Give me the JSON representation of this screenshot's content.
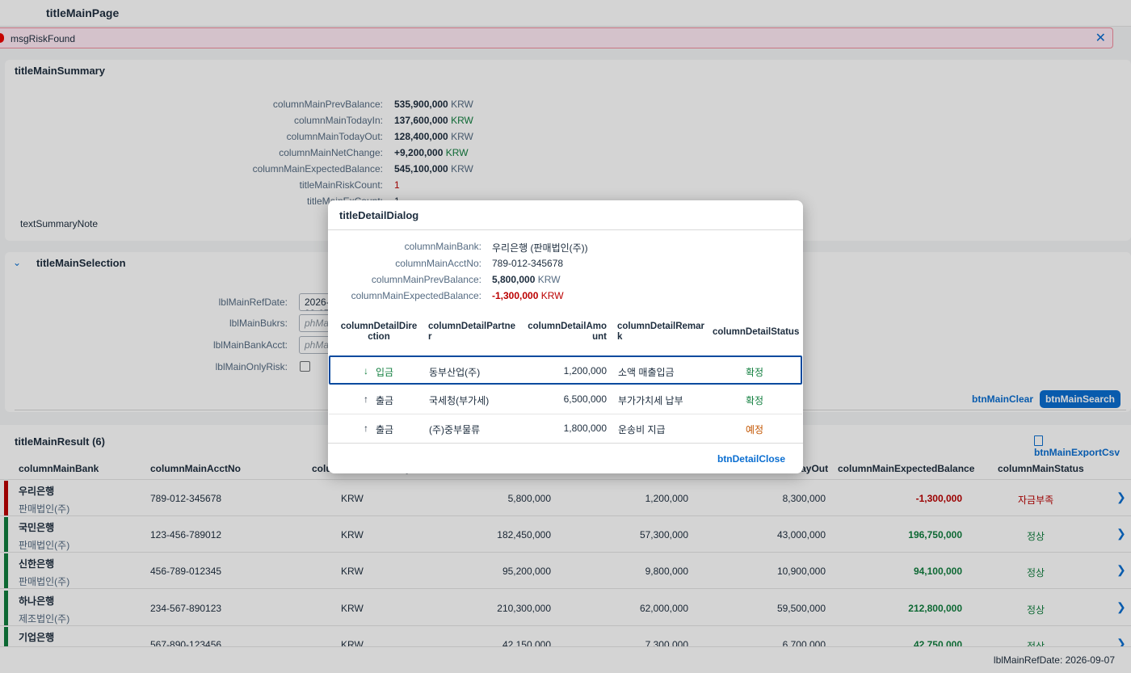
{
  "page": {
    "title": "titleMainPage"
  },
  "message": {
    "text": "msgRiskFound",
    "close_icon": "✕"
  },
  "summary": {
    "title": "titleMainSummary",
    "rows": [
      {
        "label": "columnMainPrevBalance:",
        "value": "535,900,000",
        "unit": "KRW"
      },
      {
        "label": "columnMainTodayIn:",
        "value": "137,600,000",
        "unit": "KRW"
      },
      {
        "label": "columnMainTodayOut:",
        "value": "128,400,000",
        "unit": "KRW"
      },
      {
        "label": "columnMainNetChange:",
        "value": "+9,200,000",
        "unit": "KRW"
      },
      {
        "label": "columnMainExpectedBalance:",
        "value": "545,100,000",
        "unit": "KRW"
      },
      {
        "label": "titleMainRiskCount:",
        "value": "1",
        "unit": ""
      },
      {
        "label": "titleMainExCount:",
        "value": "1",
        "unit": ""
      }
    ],
    "note": "textSummaryNote"
  },
  "selection": {
    "title": "titleMainSelection",
    "ref_date_label": "lblMainRefDate:",
    "ref_date_value": "2026-09-07",
    "bukrs_label": "lblMainBukrs:",
    "bukrs_placeholder": "phMainBukrs",
    "bank_acct_label": "lblMainBankAcct:",
    "bank_acct_placeholder": "phMainBankAcct",
    "only_risk_label": "lblMainOnlyRisk:",
    "btn_clear": "btnMainClear",
    "btn_search": "btnMainSearch"
  },
  "result": {
    "title": "titleMainResult (6)",
    "export_label": "btnMainExportCsv",
    "columns": {
      "bank": "columnMainBank",
      "acct": "columnMainAcctNo",
      "curr": "columnMainCurrency",
      "today_out": "columnMainTodayOut",
      "expected": "columnMainExpectedBalance",
      "status": "columnMainStatus"
    },
    "rows": [
      {
        "bank": "우리은행",
        "corp": "판매법인(주)",
        "acct": "789-012-345678",
        "curr": "KRW",
        "prev": "5,800,000",
        "in": "1,200,000",
        "out": "8,300,000",
        "expected": "-1,300,000",
        "status": "자금부족",
        "state": "danger",
        "bar": "#bb0000"
      },
      {
        "bank": "국민은행",
        "corp": "판매법인(주)",
        "acct": "123-456-789012",
        "curr": "KRW",
        "prev": "182,450,000",
        "in": "57,300,000",
        "out": "43,000,000",
        "expected": "196,750,000",
        "status": "정상",
        "state": "ok",
        "bar": "#107e3e"
      },
      {
        "bank": "신한은행",
        "corp": "판매법인(주)",
        "acct": "456-789-012345",
        "curr": "KRW",
        "prev": "95,200,000",
        "in": "9,800,000",
        "out": "10,900,000",
        "expected": "94,100,000",
        "status": "정상",
        "state": "ok",
        "bar": "#107e3e"
      },
      {
        "bank": "하나은행",
        "corp": "제조법인(주)",
        "acct": "234-567-890123",
        "curr": "KRW",
        "prev": "210,300,000",
        "in": "62,000,000",
        "out": "59,500,000",
        "expected": "212,800,000",
        "status": "정상",
        "state": "ok",
        "bar": "#107e3e"
      },
      {
        "bank": "기업은행",
        "corp": "",
        "acct": "567-890-123456",
        "curr": "KRW",
        "prev": "42,150,000",
        "in": "7,300,000",
        "out": "6,700,000",
        "expected": "42,750,000",
        "status": "정상",
        "state": "ok",
        "bar": "#107e3e"
      }
    ]
  },
  "footer": {
    "ref_date": "lblMainRefDate: 2026-09-07"
  },
  "dialog": {
    "title": "titleDetailDialog",
    "bank_label": "columnMainBank:",
    "bank_value": "우리은행 (판매법인(주))",
    "acct_label": "columnMainAcctNo:",
    "acct_value": "789-012-345678",
    "prev_label": "columnMainPrevBalance:",
    "prev_value": "5,800,000",
    "prev_unit": "KRW",
    "expected_label": "columnMainExpectedBalance:",
    "expected_value": "-1,300,000",
    "expected_unit": "KRW",
    "columns": {
      "direction": "columnDetailDirection",
      "partner": "columnDetailPartner",
      "amount": "columnDetailAmount",
      "remark": "columnDetailRemark",
      "status": "columnDetailStatus"
    },
    "rows": [
      {
        "arrow": "↓",
        "direction": "입금",
        "partner": "동부산업(주)",
        "amount": "1,200,000",
        "remark": "소액 매출입금",
        "status": "확정",
        "state": "ok"
      },
      {
        "arrow": "↑",
        "direction": "출금",
        "partner": "국세청(부가세)",
        "amount": "6,500,000",
        "remark": "부가가치세 납부",
        "status": "확정",
        "state": "ok"
      },
      {
        "arrow": "↑",
        "direction": "출금",
        "partner": "(주)중부물류",
        "amount": "1,800,000",
        "remark": "운송비 지급",
        "status": "예정",
        "state": "warn"
      }
    ],
    "close_label": "btnDetailClose"
  }
}
